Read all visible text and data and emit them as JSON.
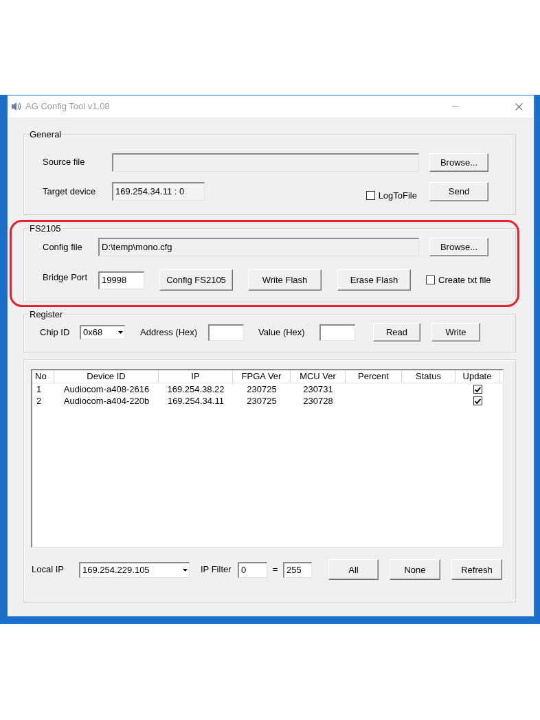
{
  "window": {
    "title": "AG Config Tool v1.08"
  },
  "general": {
    "title": "General",
    "source_file": {
      "label": "Source file"
    },
    "source_browse_button": "Browse...",
    "target_device": {
      "label": "Target device",
      "value": "169.254.34.11 : 0"
    },
    "log_to_file": {
      "label": "LogToFile",
      "checked": false
    },
    "send_button": "Send"
  },
  "fs2105": {
    "title": "FS2105",
    "highlighted": true,
    "config_file": {
      "label": "Config file",
      "value": "D:\\temp\\mono.cfg"
    },
    "config_browse_button": "Browse...",
    "bridge_port": {
      "label": "Bridge Port",
      "value": "19998"
    },
    "buttons": [
      "Config FS2105",
      "Write Flash",
      "Erase Flash"
    ],
    "create_txt_file": {
      "label": "Create txt file",
      "checked": false
    }
  },
  "register": {
    "title": "Register",
    "chip_id": {
      "label": "Chip ID",
      "value": "0x68"
    },
    "address": {
      "label": "Address (Hex)"
    },
    "value": {
      "label": "Value (Hex)"
    },
    "buttons": [
      "Read",
      "Write"
    ]
  },
  "devices": {
    "columns": [
      "No",
      "Device ID",
      "IP",
      "FPGA Ver",
      "MCU Ver",
      "Percent",
      "Status",
      "Update"
    ],
    "rows": [
      {
        "no": "1",
        "device_id": "Audiocom-a408-2616",
        "ip": "169.254.38.22",
        "fpga_ver": "230725",
        "mcu_ver": "230731",
        "update": true
      },
      {
        "no": "2",
        "device_id": "Audiocom-a404-220b",
        "ip": "169.254.34.11",
        "fpga_ver": "230725",
        "mcu_ver": "230728",
        "update": true
      }
    ]
  },
  "footer": {
    "local_ip": {
      "label": "Local IP",
      "value": "169.254.229.105"
    },
    "ip_filter": {
      "label": "IP Filter",
      "from": "0",
      "separator": "=",
      "to": "255"
    },
    "buttons": [
      "All",
      "None",
      "Refresh"
    ]
  }
}
